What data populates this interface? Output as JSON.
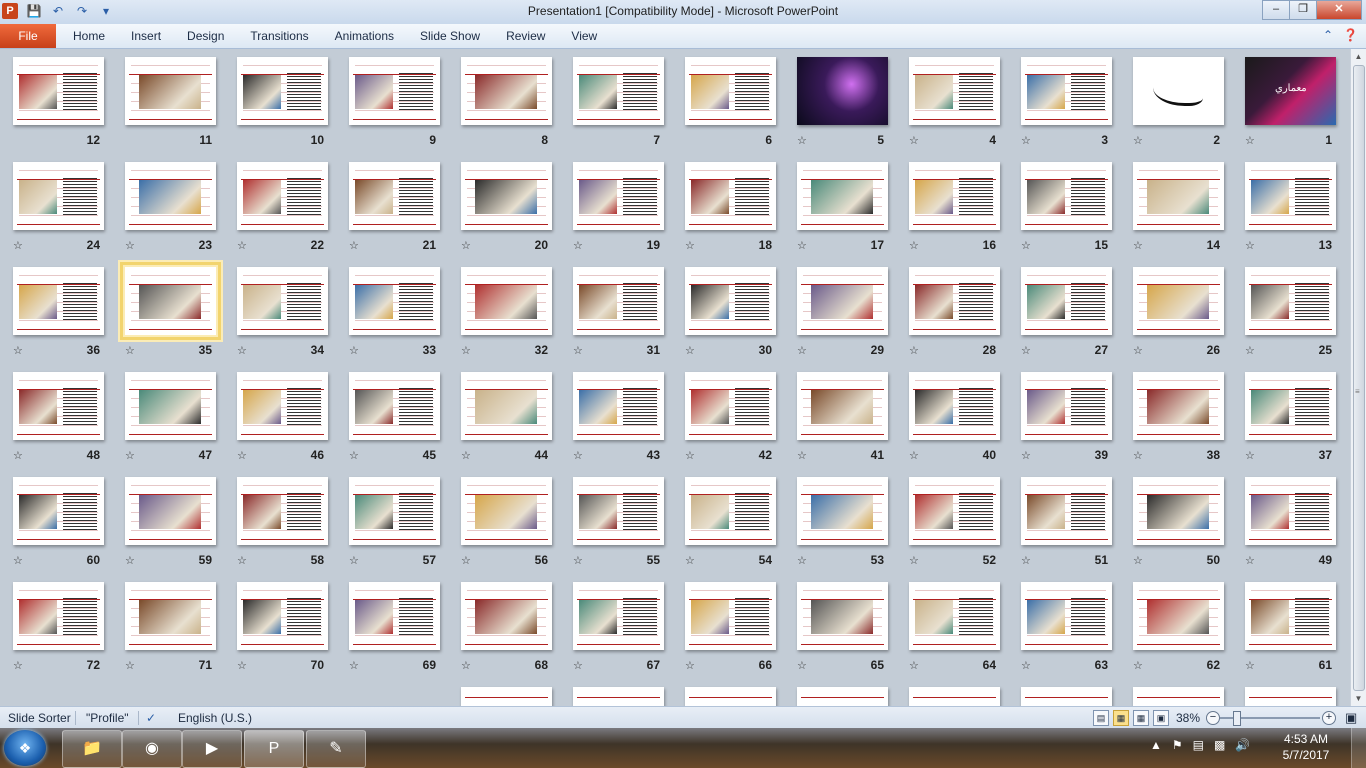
{
  "window": {
    "title": "Presentation1 [Compatibility Mode]  -  Microsoft PowerPoint",
    "app_icon_letter": "P",
    "controls": [
      "minimize-icon",
      "restore-icon",
      "close-icon"
    ]
  },
  "quick_access": [
    "save-icon",
    "undo-icon",
    "redo-icon",
    "customize-icon"
  ],
  "ribbon": {
    "file_label": "File",
    "tabs": [
      "Home",
      "Insert",
      "Design",
      "Transitions",
      "Animations",
      "Slide Show",
      "Review",
      "View"
    ]
  },
  "sorter": {
    "selected_slide": "35",
    "rows": [
      [
        "12",
        "11",
        "10",
        "9",
        "8",
        "7",
        "6",
        "5",
        "4",
        "3",
        "2",
        "1"
      ],
      [
        "24",
        "23",
        "22",
        "21",
        "20",
        "19",
        "18",
        "17",
        "16",
        "15",
        "14",
        "13"
      ],
      [
        "36",
        "35",
        "34",
        "33",
        "32",
        "31",
        "30",
        "29",
        "28",
        "27",
        "26",
        "25"
      ],
      [
        "48",
        "47",
        "46",
        "45",
        "44",
        "43",
        "42",
        "41",
        "40",
        "39",
        "38",
        "37"
      ],
      [
        "60",
        "59",
        "58",
        "57",
        "56",
        "55",
        "54",
        "53",
        "52",
        "51",
        "50",
        "49"
      ],
      [
        "72",
        "71",
        "70",
        "69",
        "68",
        "67",
        "66",
        "65",
        "64",
        "63",
        "62",
        "61"
      ]
    ],
    "slide_with_title_text": {
      "number": "1",
      "text": "معماري"
    }
  },
  "statusbar": {
    "view_name": "Slide Sorter",
    "theme": "\"Profile\"",
    "language": "English (U.S.)",
    "zoom": "38%"
  },
  "taskbar": {
    "apps": [
      "windows-explorer",
      "firefox",
      "media-player",
      "powerpoint",
      "notepad"
    ],
    "time": "4:53 AM",
    "date": "5/7/2017"
  },
  "colors": {
    "file_tab": "#d9542b",
    "sorter_background": "#c3ccd6",
    "selection": "#f2d46e",
    "slide_rule": "#b02020"
  }
}
